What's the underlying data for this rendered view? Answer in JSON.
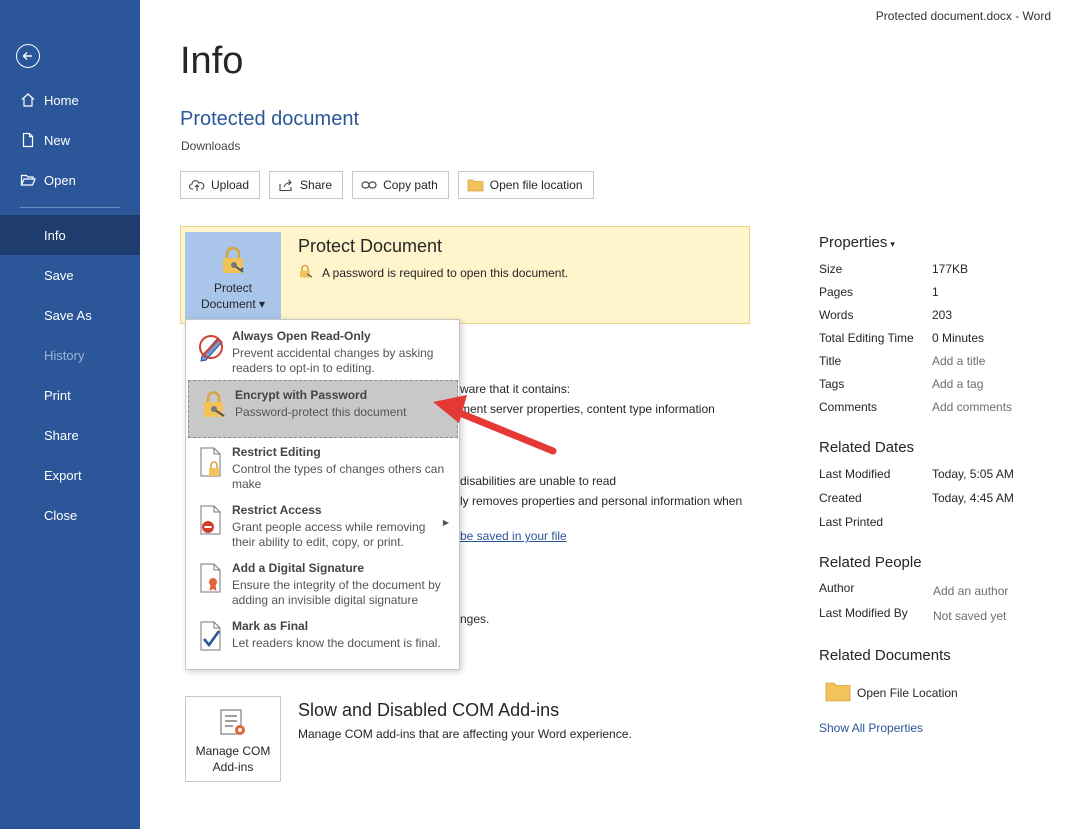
{
  "window_title": "Protected document.docx  -  Word",
  "sidebar": {
    "items": [
      {
        "label": "Home"
      },
      {
        "label": "New"
      },
      {
        "label": "Open"
      },
      {
        "label": "Info"
      },
      {
        "label": "Save"
      },
      {
        "label": "Save As"
      },
      {
        "label": "History"
      },
      {
        "label": "Print"
      },
      {
        "label": "Share"
      },
      {
        "label": "Export"
      },
      {
        "label": "Close"
      }
    ]
  },
  "page": {
    "heading": "Info",
    "doc_title": "Protected document",
    "doc_path": "Downloads"
  },
  "actions": {
    "upload": "Upload",
    "share": "Share",
    "copy_path": "Copy path",
    "open_location": "Open file location"
  },
  "protect": {
    "tile_line1": "Protect",
    "tile_line2": "Document",
    "heading": "Protect Document",
    "description": "A password is required to open this document."
  },
  "background_text": {
    "line1": "ware that it contains:",
    "line2": "ment server properties, content type information",
    "line3": "disabilities are unable to read",
    "line4": "ly removes properties and personal information when",
    "link": "be saved in your file",
    "line5": "nges."
  },
  "dropdown": {
    "items": [
      {
        "title": "Always Open Read-Only",
        "description": "Prevent accidental changes by asking readers to opt-in to editing."
      },
      {
        "title": "Encrypt with Password",
        "description": "Password-protect this document"
      },
      {
        "title": "Restrict Editing",
        "description": "Control the types of changes others can make"
      },
      {
        "title": "Restrict Access",
        "description": "Grant people access while removing their ability to edit, copy, or print."
      },
      {
        "title": "Add a Digital Signature",
        "description": "Ensure the integrity of the document by adding an invisible digital signature"
      },
      {
        "title": "Mark as Final",
        "description": "Let readers know the document is final."
      }
    ]
  },
  "addins": {
    "tile_line1": "Manage COM",
    "tile_line2": "Add-ins",
    "heading": "Slow and Disabled COM Add-ins",
    "description": "Manage COM add-ins that are affecting your Word experience."
  },
  "properties": {
    "heading": "Properties",
    "rows": [
      {
        "key": "Size",
        "value": "177KB"
      },
      {
        "key": "Pages",
        "value": "1"
      },
      {
        "key": "Words",
        "value": "203"
      },
      {
        "key": "Total Editing Time",
        "value": "0 Minutes"
      },
      {
        "key": "Title",
        "value": "Add a title"
      },
      {
        "key": "Tags",
        "value": "Add a tag"
      },
      {
        "key": "Comments",
        "value": "Add comments"
      }
    ]
  },
  "related_dates": {
    "heading": "Related Dates",
    "rows": [
      {
        "key": "Last Modified",
        "value": "Today, 5:05 AM"
      },
      {
        "key": "Created",
        "value": "Today, 4:45 AM"
      },
      {
        "key": "Last Printed",
        "value": ""
      }
    ]
  },
  "related_people": {
    "heading": "Related People",
    "rows": [
      {
        "key": "Author",
        "value": "Add an author"
      },
      {
        "key": "Last Modified By",
        "value": "Not saved yet"
      }
    ]
  },
  "related_documents": {
    "heading": "Related Documents",
    "open_file_location": "Open File Location",
    "show_all": "Show All Properties"
  },
  "colors": {
    "sidebar": "#2b579a",
    "sidebar_active": "#1e3d6e",
    "accent": "#2b579a",
    "protect_bg": "#fff4cc",
    "callout_arrow": "#e53935"
  }
}
